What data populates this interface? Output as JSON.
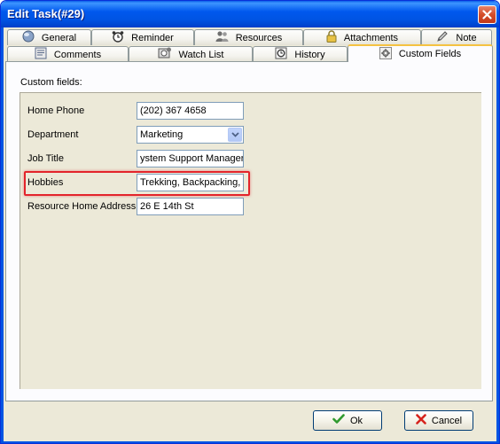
{
  "window": {
    "title": "Edit Task(#29)"
  },
  "tabs_row1": [
    {
      "label": "General",
      "icon": "globe-icon"
    },
    {
      "label": "Reminder",
      "icon": "alarm-clock-icon"
    },
    {
      "label": "Resources",
      "icon": "people-icon"
    },
    {
      "label": "Attachments",
      "icon": "lock-icon"
    },
    {
      "label": "Note",
      "icon": "pen-icon"
    }
  ],
  "tabs_row2": [
    {
      "label": "Comments",
      "icon": "comments-icon"
    },
    {
      "label": "Watch List",
      "icon": "watch-list-icon"
    },
    {
      "label": "History",
      "icon": "history-icon"
    },
    {
      "label": "Custom Fields",
      "icon": "gear-icon",
      "active": true
    }
  ],
  "panel": {
    "label": "Custom fields:"
  },
  "fields": [
    {
      "label": "Home Phone",
      "value": "(202) 367 4658"
    },
    {
      "label": "Department",
      "value": "Marketing",
      "type": "select"
    },
    {
      "label": "Job Title",
      "value": "ystem Support Manager"
    },
    {
      "label": "Hobbies",
      "value": "Trekking, Backpacking,"
    },
    {
      "label": "Resource Home Address",
      "value": "26 E 14th St"
    }
  ],
  "buttons": {
    "ok": "Ok",
    "cancel": "Cancel"
  },
  "colors": {
    "highlight": "#e3242b",
    "titlebar": "#0054e3",
    "active_tab_accent": "#f5c242"
  }
}
